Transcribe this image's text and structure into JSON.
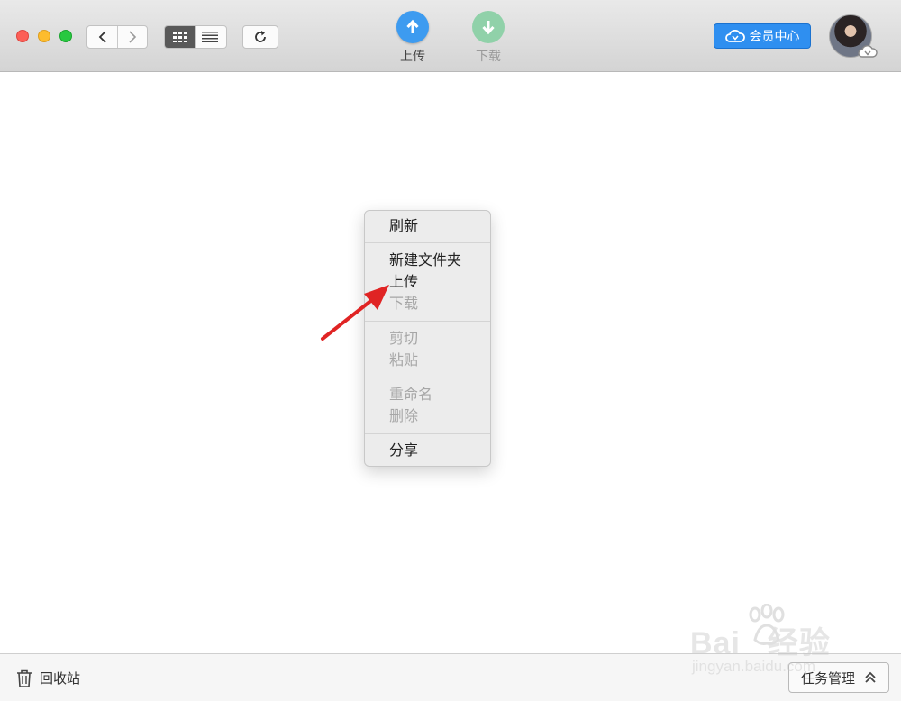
{
  "toolbar": {
    "upload_label": "上传",
    "download_label": "下载",
    "vip_label": "会员中心"
  },
  "context_menu": {
    "refresh": "刷新",
    "new_folder": "新建文件夹",
    "upload": "上传",
    "download": "下载",
    "cut": "剪切",
    "paste": "粘贴",
    "rename": "重命名",
    "delete": "删除",
    "share": "分享"
  },
  "bottom": {
    "trash_label": "回收站",
    "task_label": "任务管理"
  },
  "watermark": {
    "brand": "Bai",
    "brand_suffix": "经验",
    "site": "jingyan.baidu.com"
  },
  "colors": {
    "accent": "#2f8ff0",
    "upload": "#3d9bf0",
    "download": "#90d1a9",
    "annotation_arrow": "#e02424"
  }
}
